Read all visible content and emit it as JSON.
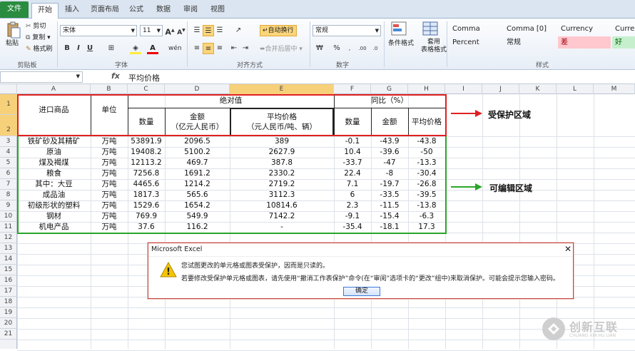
{
  "tabs": [
    "文件",
    "开始",
    "插入",
    "页面布局",
    "公式",
    "数据",
    "审阅",
    "视图"
  ],
  "ribbon": {
    "paste": "粘贴",
    "cut": "剪切",
    "copy": "复制 ▾",
    "format_painter": "格式刷",
    "font_name": "宋体",
    "font_size": "11",
    "wrap_text": "自动换行",
    "merge_center": "合并后居中 ▾",
    "number_format": "常规",
    "conditional_format": "条件格式",
    "table_format": "套用\n表格格式",
    "styles": [
      {
        "label": "Comma",
        "bg": "#ffffff",
        "color": "#222"
      },
      {
        "label": "Comma [0]",
        "bg": "#ffffff",
        "color": "#222"
      },
      {
        "label": "Currency",
        "bg": "#ffffff",
        "color": "#222"
      },
      {
        "label": "Curren",
        "bg": "#ffffff",
        "color": "#222"
      },
      {
        "label": "Percent",
        "bg": "#ffffff",
        "color": "#222"
      },
      {
        "label": "常规",
        "bg": "#ffffff",
        "color": "#222"
      },
      {
        "label": "差",
        "bg": "#ffc7ce",
        "color": "#9c0006"
      },
      {
        "label": "好",
        "bg": "#c6efce",
        "color": "#006100"
      }
    ],
    "groups": [
      "剪贴板",
      "字体",
      "对齐方式",
      "数字",
      "样式"
    ]
  },
  "formula_bar": {
    "name_box": "",
    "fx": "fx",
    "content": "平均价格"
  },
  "columns": [
    "A",
    "B",
    "C",
    "D",
    "E",
    "F",
    "G",
    "H",
    "I",
    "J",
    "K",
    "L",
    "M"
  ],
  "rows": [
    "1",
    "2",
    "3",
    "4",
    "5",
    "6",
    "7",
    "8",
    "9",
    "10",
    "11",
    "12",
    "13",
    "14",
    "15",
    "16",
    "17",
    "18",
    "19",
    "20",
    "21"
  ],
  "header": {
    "product": "进口商品",
    "unit": "单位",
    "abs": "绝对值",
    "yoy": "同比（%）",
    "qty": "数量",
    "amount": "金额\n（亿元人民币）",
    "avg": "平均价格\n（元人民币/吨、辆）",
    "qty2": "数量",
    "amount2": "金额",
    "avg2": "平均价格"
  },
  "table": [
    [
      "铁矿砂及其精矿",
      "万吨",
      "53891.9",
      "2096.5",
      "389",
      "-0.1",
      "-43.9",
      "-43.8"
    ],
    [
      "原油",
      "万吨",
      "19408.2",
      "5100.2",
      "2627.9",
      "10.4",
      "-39.6",
      "-50"
    ],
    [
      "煤及褐煤",
      "万吨",
      "12113.2",
      "469.7",
      "387.8",
      "-33.7",
      "-47",
      "-13.3"
    ],
    [
      "粮食",
      "万吨",
      "7256.8",
      "1691.2",
      "2330.2",
      "22.4",
      "-8",
      "-30.4"
    ],
    [
      "其中：大豆",
      "万吨",
      "4465.6",
      "1214.2",
      "2719.2",
      "7.1",
      "-19.7",
      "-26.8"
    ],
    [
      "成品油",
      "万吨",
      "1817.3",
      "565.6",
      "3112.3",
      "6",
      "-33.5",
      "-39.5"
    ],
    [
      "初级形状的塑料",
      "万吨",
      "1529.6",
      "1654.2",
      "10814.6",
      "2.3",
      "-11.5",
      "-13.8"
    ],
    [
      "钢材",
      "万吨",
      "769.9",
      "549.9",
      "7142.2",
      "-9.1",
      "-15.4",
      "-6.3"
    ],
    [
      "机电产品",
      "万吨",
      "37.6",
      "116.2",
      "-",
      "-35.4",
      "-18.1",
      "17.3"
    ]
  ],
  "notes": {
    "protected": "受保护区域",
    "editable": "可编辑区域"
  },
  "dialog": {
    "title": "Microsoft Excel",
    "line1": "您试图更改的单元格或图表受保护，因而是只读的。",
    "line2": "若要修改受保护单元格或图表，请先使用“撤消工作表保护”命令(在“审阅”选项卡的“更改”组中)来取消保护。可能会提示您输入密码。",
    "ok": "确定"
  },
  "logo": {
    "text": "创新互联",
    "sub": "CHUANG XIN HU LIAN"
  },
  "colors": {
    "protected": "#e02020",
    "editable": "#2aa52a",
    "file_tab": "#2a8c3f",
    "selected_header": "#f7d07a"
  }
}
